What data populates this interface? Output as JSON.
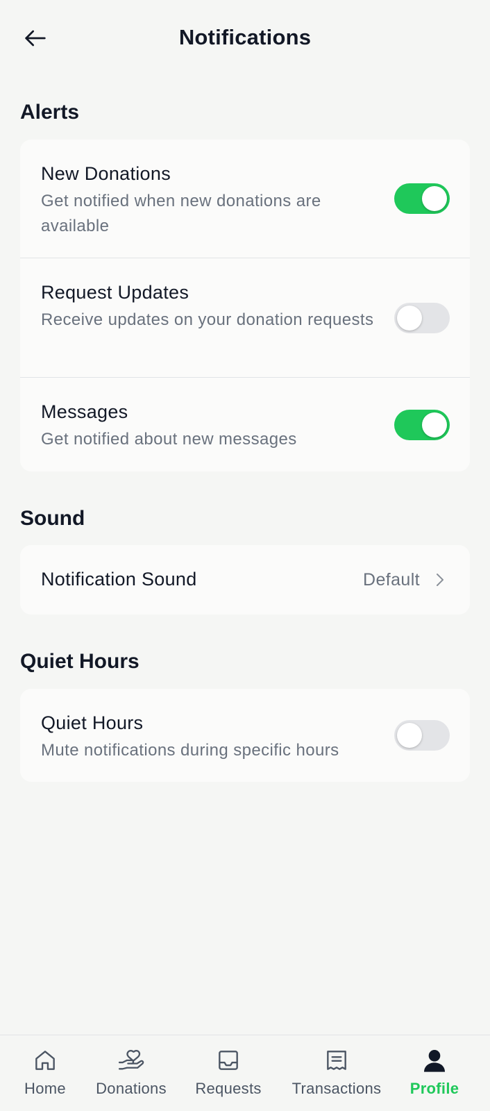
{
  "header": {
    "title": "Notifications",
    "back_icon": "arrow-left-icon"
  },
  "alerts": {
    "section_title": "Alerts",
    "items": [
      {
        "title": "New Donations",
        "subtitle": "Get notified when new donations are available",
        "enabled": true
      },
      {
        "title": "Request Updates",
        "subtitle": "Receive updates on your donation requests",
        "enabled": false
      },
      {
        "title": "Messages",
        "subtitle": "Get notified about new messages",
        "enabled": true
      }
    ]
  },
  "sound": {
    "section_title": "Sound",
    "item": {
      "title": "Notification Sound",
      "value": "Default",
      "icon": "chevron-right-icon"
    }
  },
  "quiet_hours": {
    "section_title": "Quiet Hours",
    "item": {
      "title": "Quiet Hours",
      "subtitle": "Mute notifications during specific hours",
      "enabled": false
    }
  },
  "bottom_nav": {
    "items": [
      {
        "label": "Home",
        "icon": "home-icon",
        "active": false
      },
      {
        "label": "Donations",
        "icon": "donation-hand-icon",
        "active": false
      },
      {
        "label": "Requests",
        "icon": "inbox-icon",
        "active": false
      },
      {
        "label": "Transactions",
        "icon": "receipt-icon",
        "active": false
      },
      {
        "label": "Profile",
        "icon": "user-icon",
        "active": true
      }
    ]
  },
  "colors": {
    "accent": "#1fc85a",
    "background": "#f5f6f4",
    "card": "#fbfbfa",
    "text_primary": "#121826",
    "text_secondary": "#69717d",
    "toggle_off": "#e3e4e7"
  }
}
